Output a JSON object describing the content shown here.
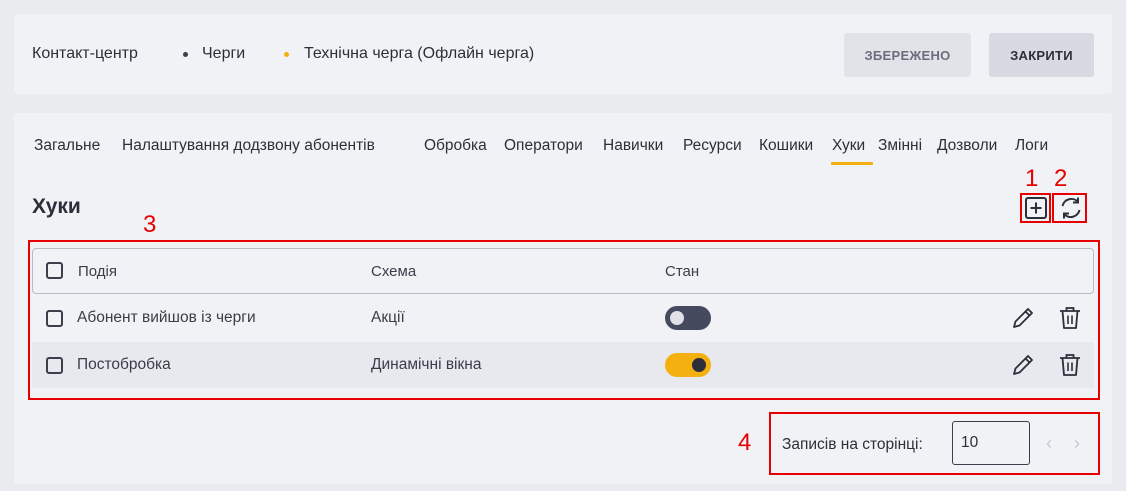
{
  "breadcrumb": {
    "items": [
      "Контакт-центр",
      "Черги",
      "Технічна черга (Офлайн черга)"
    ],
    "dot_colors": [
      "#3b3f4c",
      "#f4b00f"
    ]
  },
  "header": {
    "saved_label": "ЗБЕРЕЖЕНО",
    "close_label": "ЗАКРИТИ"
  },
  "tabs": {
    "items": [
      "Загальне",
      "Налаштування додзвону абонентів",
      "Обробка",
      "Оператори",
      "Навички",
      "Ресурси",
      "Кошики",
      "Хуки",
      "Змінні",
      "Дозволи",
      "Логи"
    ],
    "active": "Хуки",
    "accent": "#f4b00f"
  },
  "section": {
    "title": "Хуки"
  },
  "toolbar": {
    "add_icon": "plus-square-icon",
    "refresh_icon": "refresh-icon"
  },
  "annotations": [
    "1",
    "2",
    "3",
    "4"
  ],
  "annotation_color": "#e60000",
  "table": {
    "columns": [
      "Подія",
      "Схема",
      "Стан"
    ],
    "rows": [
      {
        "event": "Абонент вийшов із черги",
        "scheme": "Акції",
        "state": false
      },
      {
        "event": "Постобробка",
        "scheme": "Динамічні вікна",
        "state": true
      }
    ],
    "toggle_on_color": "#f4b00f",
    "toggle_off_color": "#454a5e"
  },
  "pager": {
    "label": "Записів на сторінці:",
    "value": "10"
  }
}
